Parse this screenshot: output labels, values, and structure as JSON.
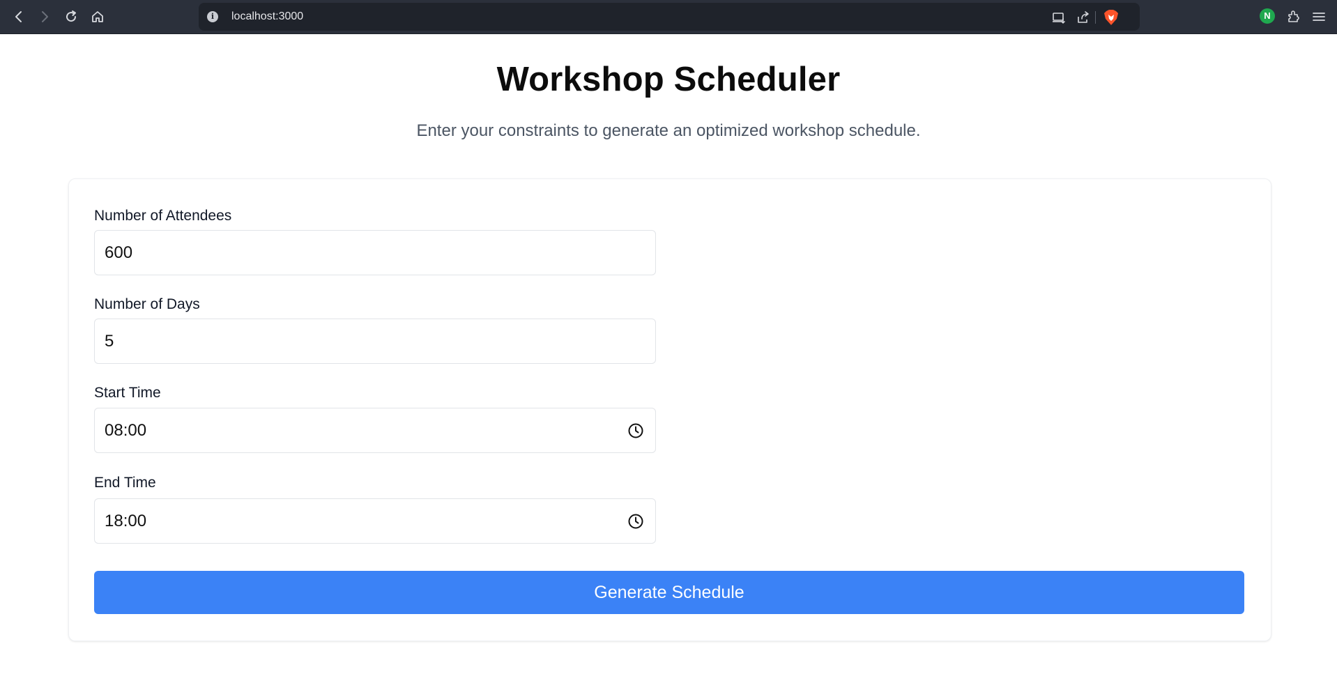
{
  "browser": {
    "url": "localhost:3000",
    "extension_badge": "N",
    "icons": [
      "back-icon",
      "forward-icon",
      "reload-icon",
      "home-icon",
      "site-info-icon",
      "install-app-icon",
      "share-icon",
      "brave-shield-icon",
      "extensions-icon",
      "menu-icon"
    ]
  },
  "page": {
    "title": "Workshop Scheduler",
    "subtitle": "Enter your constraints to generate an optimized workshop schedule."
  },
  "form": {
    "attendees": {
      "label": "Number of Attendees",
      "value": "600"
    },
    "days": {
      "label": "Number of Days",
      "value": "5"
    },
    "start_time": {
      "label": "Start Time",
      "value": "08:00"
    },
    "end_time": {
      "label": "End Time",
      "value": "18:00"
    },
    "submit_label": "Generate Schedule"
  },
  "colors": {
    "accent": "#3b82f6",
    "chrome_bg": "#2b303b",
    "urlbar_bg": "#1f232b",
    "extension_green": "#1fa84f"
  }
}
